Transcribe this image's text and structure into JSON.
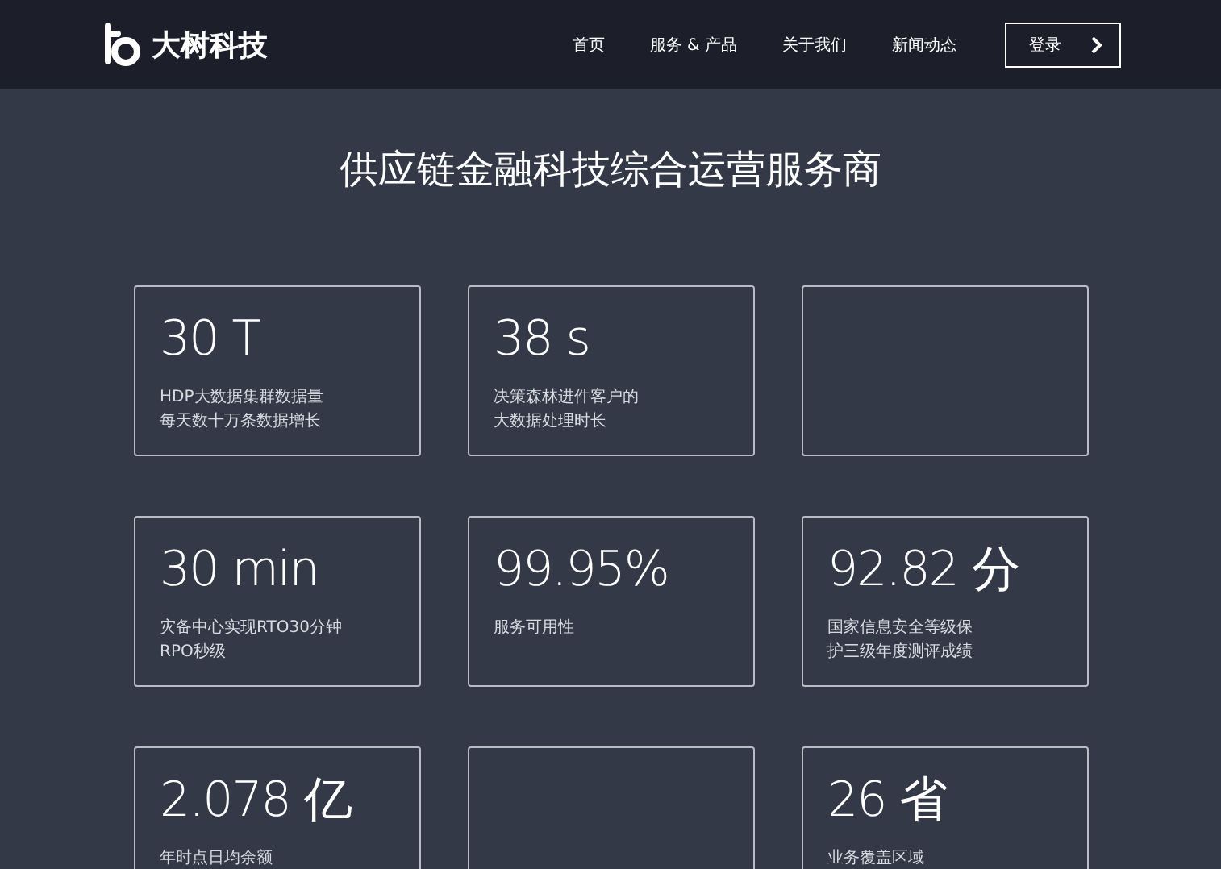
{
  "header": {
    "logo_text": "大树科技",
    "nav": [
      {
        "label": "首页"
      },
      {
        "label": "服务 & 产品"
      },
      {
        "label": "关于我们"
      },
      {
        "label": "新闻动态"
      }
    ],
    "login_button": "登录"
  },
  "title": "供应链金融科技综合运营服务商",
  "stats": [
    {
      "kind": "stat",
      "value": "30 T",
      "description": [
        "HDP大数据集群数据量",
        "每天数十万条数据增长"
      ]
    },
    {
      "kind": "stat",
      "value": "38 s",
      "description": [
        "决策森林进件客户的",
        "大数据处理时长"
      ]
    },
    {
      "kind": "blank"
    },
    {
      "kind": "stat",
      "value": "30 min",
      "description": [
        "灾备中心实现RTO30分钟",
        "RPO秒级"
      ]
    },
    {
      "kind": "stat",
      "value": "99.95%",
      "description": [
        "服务可用性"
      ]
    },
    {
      "kind": "stat",
      "value": "92.82 分",
      "description": [
        "国家信息安全等级保",
        "护三级年度测评成绩"
      ]
    },
    {
      "kind": "stat",
      "value": "2.078 亿",
      "description": [
        "年时点日均余额"
      ]
    },
    {
      "kind": "blank"
    },
    {
      "kind": "stat",
      "value": "26 省",
      "description": [
        "业务覆盖区域"
      ]
    }
  ]
}
